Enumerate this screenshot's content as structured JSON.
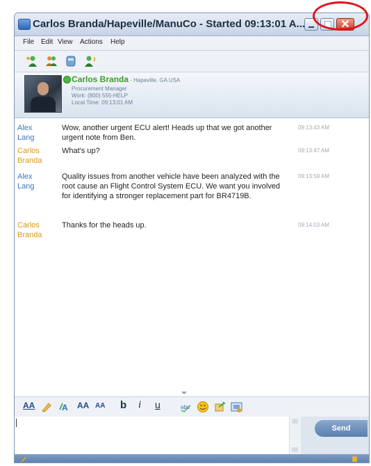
{
  "window": {
    "title": "Carlos Branda/Hapeville/ManuCo - Started 09:13:01 A..."
  },
  "menu": [
    "File",
    "Edit",
    "View",
    "Actions",
    "Help"
  ],
  "toolbar_icons": [
    "add-person-icon",
    "group-icon",
    "meeting-icon",
    "call-icon"
  ],
  "contact": {
    "name": "Carlos Branda",
    "location": " - Hapeville, GA USA",
    "title": "Procurement Manager",
    "work": "Work: (800) 555-HELP",
    "local_time": "Local Time: 09:13:01 AM",
    "status_color": "#4cbb3a"
  },
  "messages": [
    {
      "sender": "Alex Lang",
      "sender_color": "#3c74c4",
      "text": "Wow, another urgent ECU alert!  Heads up that we got another urgent note from Ben.",
      "time": "09:13:43 AM"
    },
    {
      "sender": "Carlos Branda",
      "sender_color": "#d89a12",
      "text": "What's up?",
      "time": "09:13:47 AM"
    },
    {
      "sender": "Alex Lang",
      "sender_color": "#3c74c4",
      "text": "Quality issues from another vehicle have been analyzed with the root cause an Flight Control System ECU.  We want you involved for identifying a stronger replacement part for BR4719B.",
      "time": "09:13:59 AM"
    },
    {
      "sender": "Carlos Branda",
      "sender_color": "#d89a12",
      "text": "Thanks for the heads up.",
      "time": "09:14:03 AM"
    }
  ],
  "format_bar": {
    "font": "AA",
    "grow": "AA",
    "shrink": "AA",
    "bold": "b",
    "italic": "i",
    "underline": "u"
  },
  "compose": {
    "value": "",
    "send_label": "Send"
  },
  "colors": {
    "annotation": "#e1141b",
    "accent": "#5b7eae"
  }
}
